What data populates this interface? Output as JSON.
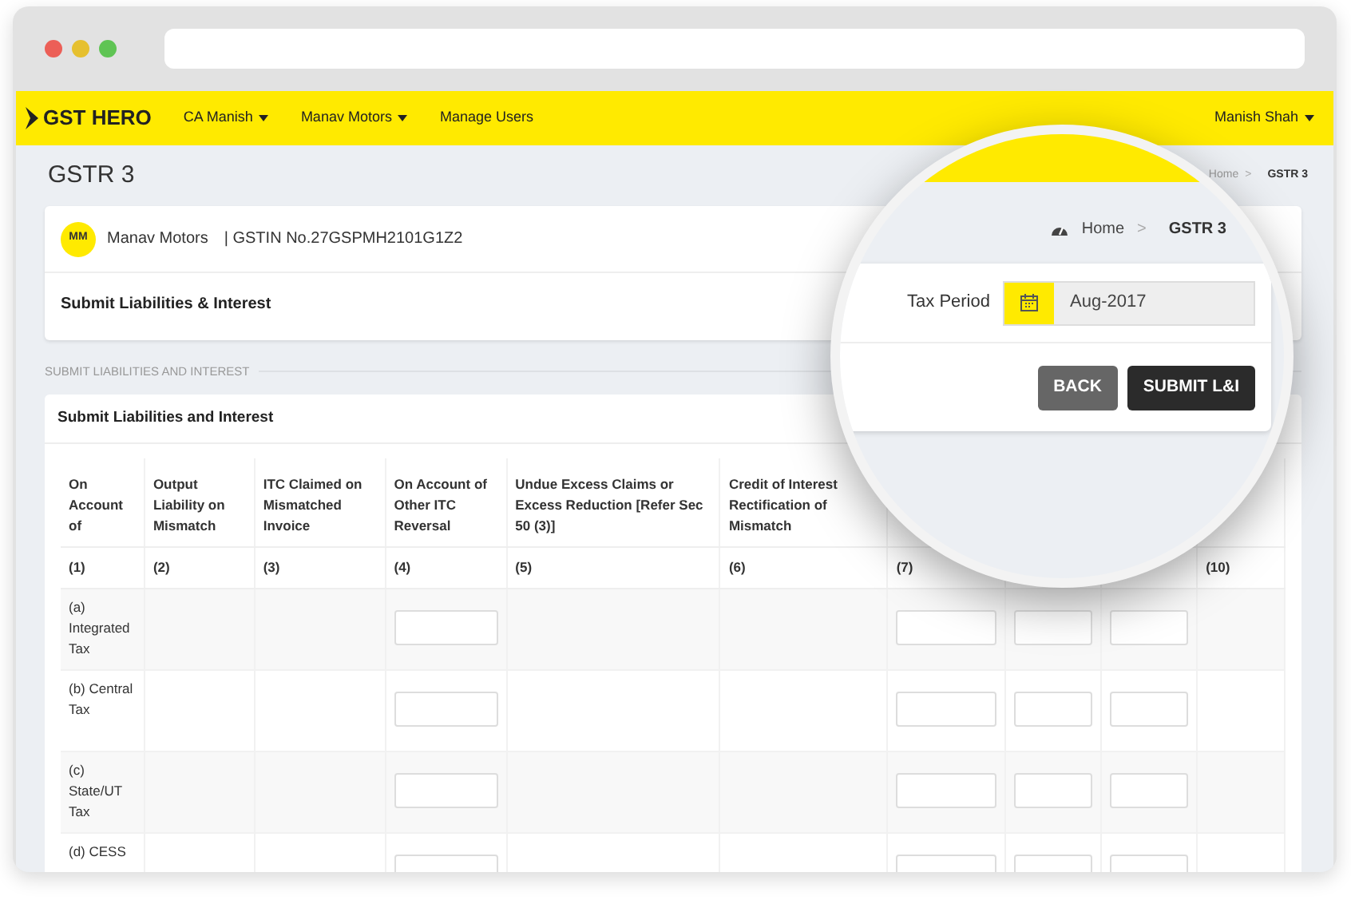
{
  "navbar": {
    "logo": "GST HERO",
    "menus": [
      {
        "label": "CA Manish",
        "has_menu": true
      },
      {
        "label": "Manav Motors",
        "has_menu": true
      },
      {
        "label": "Manage Users",
        "has_menu": false
      }
    ],
    "user": {
      "label": "Manish Shah",
      "has_menu": true
    }
  },
  "page": {
    "title": "GSTR 3",
    "breadcrumb": [
      "Home",
      "GSTR 3"
    ],
    "separator": ">"
  },
  "company": {
    "initials": "MM",
    "name": "Manav Motors",
    "gstin": "| GSTIN No.27GSPMH2101G1Z2",
    "section_title": "Submit Liabilities & Interest"
  },
  "section_label": "SUBMIT LIABILITIES AND INTEREST",
  "table_card": {
    "title": "Submit Liabilities and Interest",
    "columns": [
      {
        "header": "On Account of",
        "number": "(1)"
      },
      {
        "header": "Output Liability on Mismatch",
        "number": "(2)"
      },
      {
        "header": "ITC Claimed on Mismatched Invoice",
        "number": "(3)"
      },
      {
        "header": "On Account of Other ITC Reversal",
        "number": "(4)"
      },
      {
        "header": "Undue Excess Claims or Excess Reduction [Refer Sec 50 (3)]",
        "number": "(5)"
      },
      {
        "header": "Credit of Interest Rectification of Mismatch",
        "number": "(6)"
      },
      {
        "number": "(7)"
      },
      {},
      {},
      {
        "number": "(10)"
      }
    ],
    "rows": [
      {
        "label": "(a) Integrated Tax",
        "cells": [
          {
            "input": false
          },
          {
            "input": false
          },
          {
            "input": true
          },
          {
            "input": false
          },
          {
            "input": false
          },
          {
            "input": true
          },
          {
            "input": true
          },
          {
            "input": true
          },
          {
            "input": false
          }
        ]
      },
      {
        "label": "(b) Central Tax",
        "cells": [
          {
            "input": false
          },
          {
            "input": false
          },
          {
            "input": true
          },
          {
            "input": false
          },
          {
            "input": false
          },
          {
            "input": true
          },
          {
            "input": true
          },
          {
            "input": true
          },
          {
            "input": false
          }
        ]
      },
      {
        "label": "(c) State/UT Tax",
        "cells": [
          {
            "input": false
          },
          {
            "input": false
          },
          {
            "input": true
          },
          {
            "input": false
          },
          {
            "input": false
          },
          {
            "input": true
          },
          {
            "input": true
          },
          {
            "input": true
          },
          {
            "input": false
          }
        ]
      },
      {
        "label": "(d) CESS",
        "cells": [
          {
            "input": false
          },
          {
            "input": false
          },
          {
            "input": true
          },
          {
            "input": false
          },
          {
            "input": false
          },
          {
            "input": true
          },
          {
            "input": true
          },
          {
            "input": true
          },
          {
            "input": false
          }
        ]
      }
    ]
  },
  "magnifier": {
    "breadcrumb": [
      "Home",
      "GSTR 3"
    ],
    "separator": ">",
    "tax_period": {
      "label": "Tax Period",
      "value": "Aug-2017"
    },
    "buttons": [
      {
        "label": "BACK",
        "kind": "secondary"
      },
      {
        "label": "SUBMIT L&I",
        "kind": "primary"
      }
    ]
  }
}
